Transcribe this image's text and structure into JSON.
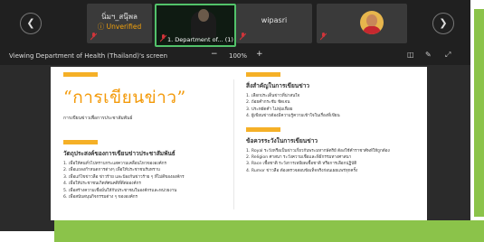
{
  "participants": {
    "prev_icon": "chevron-left-icon",
    "next_icon": "chevron-right-icon",
    "tiles": [
      {
        "name": "นิ่มฯ_สนุ๊พล",
        "status": "Unverified"
      },
      {
        "name": "1. Department of...",
        "badge": "(1)"
      },
      {
        "name": "wipasri"
      },
      {
        "name": ""
      }
    ]
  },
  "toolbar": {
    "title": "Viewing Department of Health (Thailand)'s screen",
    "zoom_out": "−",
    "zoom": "100%",
    "zoom_in": "+",
    "icons": [
      "view-options-icon",
      "annotate-icon",
      "fullscreen-icon"
    ]
  },
  "slide": {
    "title": "“การเขียนข่าว”",
    "subtitle": "การเขียนข่าวเพื่อการประชาสัมพันธ์",
    "left_heading": "วัตถุประสงค์ของการเขียนข่าวประชาสัมพันธ์",
    "left_items": [
      "1. เพื่อให้คนทั่วไปทราบกระแสความเคลื่อนไหวขององค์กร",
      "2. เพื่อแถลงกำหนดการต่างๆ เพื่อให้ประชาชนรับทราบ",
      "3. เพื่อแก้ไขข่าวลือ ข่าวร้าย และป้องกันข่าวร้าย ๆ ที่ไม่ดีขององค์กร",
      "4. เพื่อให้ประชาชนเกิดทัศนคติที่ดีต่อองค์กร",
      "5. เพื่อสร้างความเชื่อมั่นให้กับประชาชนในองค์กรและหน่วยงาน",
      "6. เพื่อสนับสนุนกิจกรรมต่าง ๆ ขององค์กร"
    ],
    "right_heading1": "สิ่งสำคัญในการเขียนข่าว",
    "right_items1": [
      "1. เลือกประเด็นข่าวที่น่าสนใจ",
      "2. ถ้อยคำกระชับ ชัดเจน",
      "3. ประหยัดคำ ไม่ฟุ่มเฟือย",
      "4. ผู้เขียนข่าวต้องมีความรู้ความเข้าใจในเรื่องที่เขียน"
    ],
    "right_heading2": "ข้อควรระวังในการเขียนข่าว",
    "right_items2": [
      "1. Royal ระวังหรือเป็นข่าวเกี่ยวกับพระมหากษัตริย์ ต้องใช้คำราชาศัพท์ให้ถูกต้อง",
      "2. Religion ศาสนา ระวังความเชื่อและพิธีกรรมทางศาสนา",
      "3. Race เชื้อชาติ ระวังการเหยียดเชื้อชาติ หรือการเลือกปฏิบัติ",
      "4. Rumor ข่าวลือ ต้องตรวจสอบข้อเท็จจริงก่อนเผยแพร่ทุกครั้ง"
    ]
  }
}
